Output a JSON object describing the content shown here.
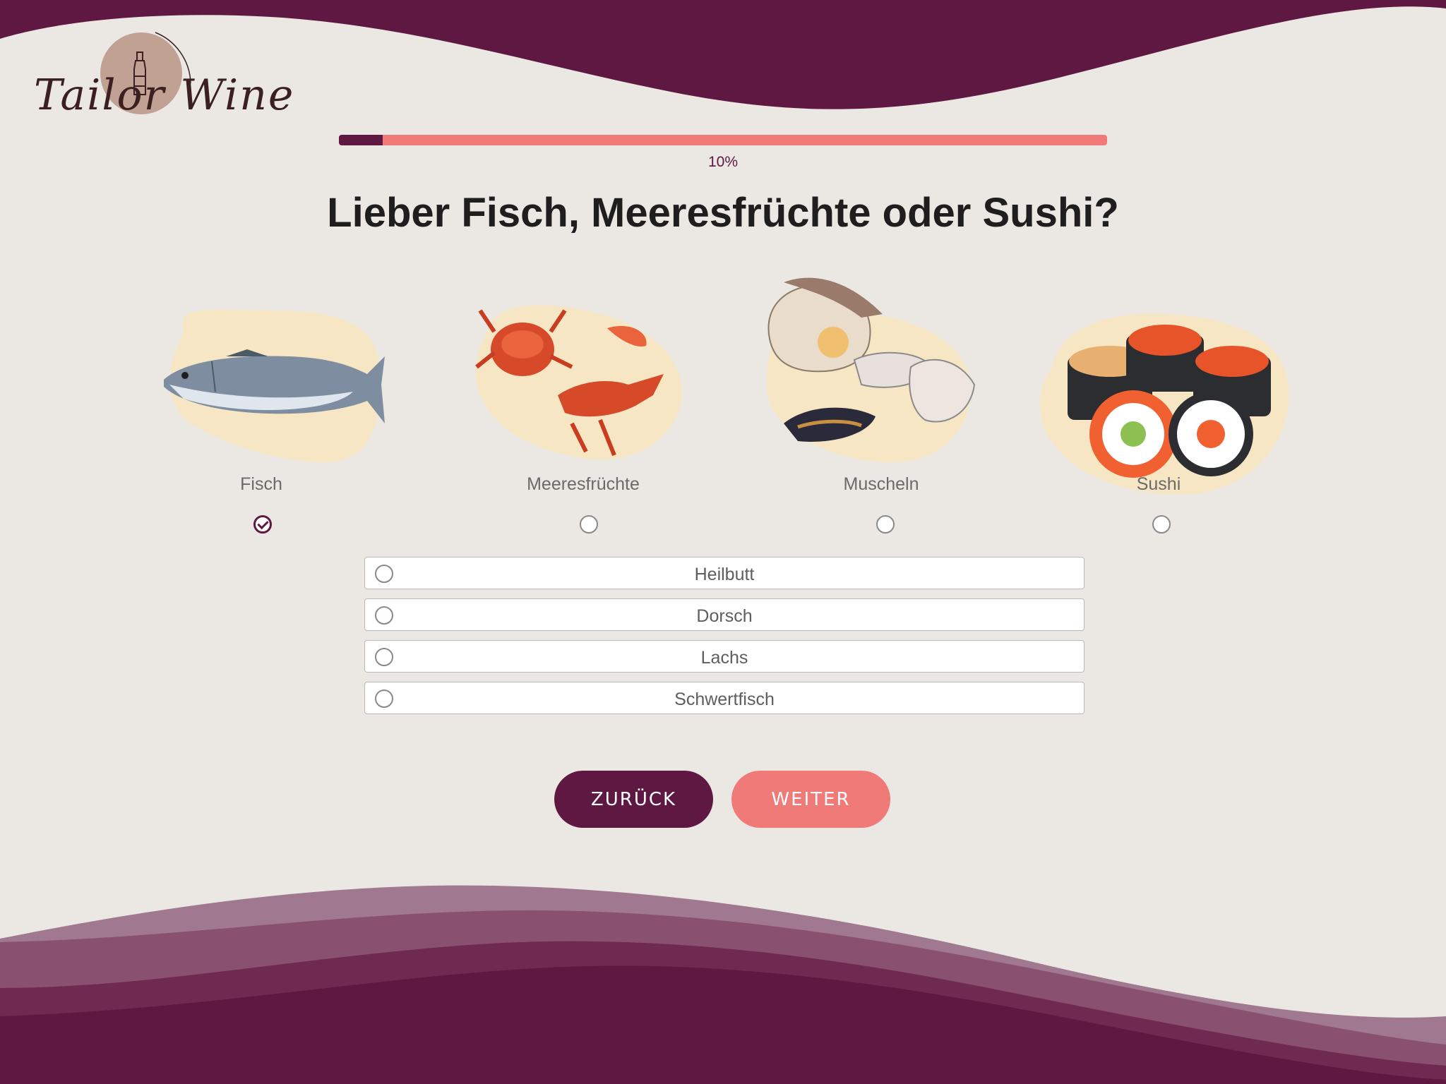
{
  "brand": {
    "logo_text": "Tailor Wine"
  },
  "progress": {
    "percent": 10,
    "label": "10%"
  },
  "question": "Lieber Fisch, Meeresfrüchte oder Sushi?",
  "categories": [
    {
      "label": "Fisch",
      "selected": true,
      "icon": "fish-image"
    },
    {
      "label": "Meeresfrüchte",
      "selected": false,
      "icon": "seafood-image"
    },
    {
      "label": "Muscheln",
      "selected": false,
      "icon": "shellfish-image"
    },
    {
      "label": "Sushi",
      "selected": false,
      "icon": "sushi-image"
    }
  ],
  "options": [
    {
      "label": "Heilbutt"
    },
    {
      "label": "Dorsch"
    },
    {
      "label": "Lachs"
    },
    {
      "label": "Schwertfisch"
    }
  ],
  "buttons": {
    "back": "ZURÜCK",
    "next": "WEITER"
  },
  "colors": {
    "primary": "#5f1842",
    "accent": "#f07a78",
    "background": "#ebe8e3",
    "blob": "#f7e6c4"
  }
}
